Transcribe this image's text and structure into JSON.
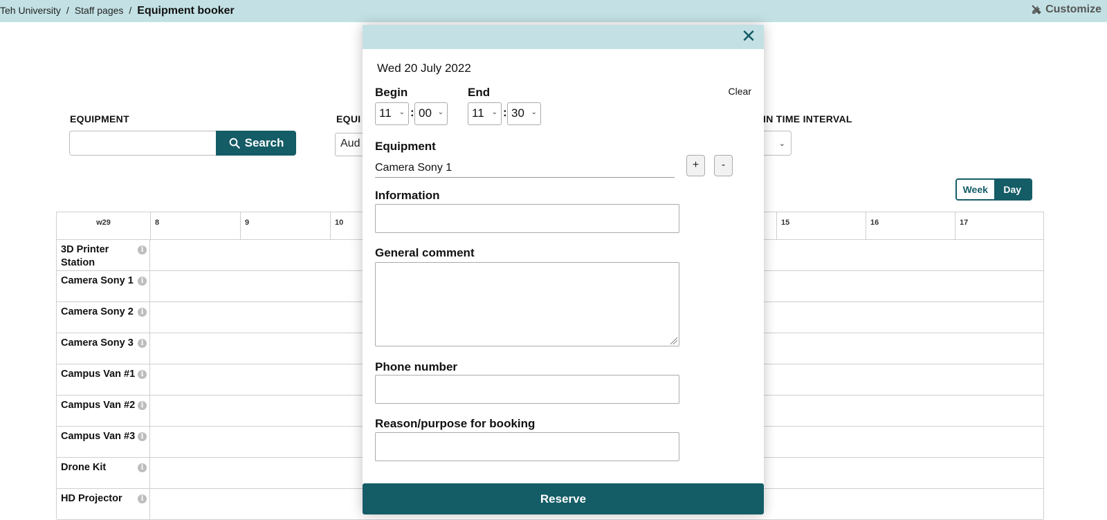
{
  "breadcrumb": {
    "items": [
      "Teh University",
      "Staff pages"
    ],
    "current": "Equipment booker"
  },
  "header": {
    "customize_label": "Customize",
    "customize_icon": "tools-icon"
  },
  "filters": {
    "equipment_label": "EQUIPMENT",
    "equipment_value": "",
    "search_label": "Search",
    "type_label_visible": "EQUI",
    "type_value_visible": "Aud",
    "interval_label_visible": "IN TIME INTERVAL"
  },
  "view": {
    "week_label": "Week",
    "day_label": "Day",
    "active": "Day"
  },
  "grid": {
    "week": "w29",
    "hours": [
      "8",
      "9",
      "10",
      "15",
      "16",
      "17"
    ],
    "rows": [
      "3D Printer Station",
      "Camera Sony 1",
      "Camera Sony 2",
      "Camera Sony 3",
      "Campus Van #1",
      "Campus Van #2",
      "Campus Van #3",
      "Drone Kit",
      "HD Projector"
    ]
  },
  "modal": {
    "close_symbol": "✕",
    "date": "Wed 20 July 2022",
    "begin_label": "Begin",
    "end_label": "End",
    "clear_label": "Clear",
    "begin_hour": "11",
    "begin_minute": "00",
    "end_hour": "11",
    "end_minute": "30",
    "equipment_label": "Equipment",
    "equipment_value": "Camera Sony 1",
    "plus_label": "+",
    "minus_label": "-",
    "information_label": "Information",
    "information_value": "",
    "comment_label": "General comment",
    "comment_value": "",
    "phone_label": "Phone number",
    "phone_value": "",
    "reason_label": "Reason/purpose for booking",
    "reason_value": "",
    "reserve_label": "Reserve"
  },
  "colors": {
    "accent": "#145c66",
    "header_bg": "#c3e1e4",
    "grid_line": "#cfcfcf"
  }
}
